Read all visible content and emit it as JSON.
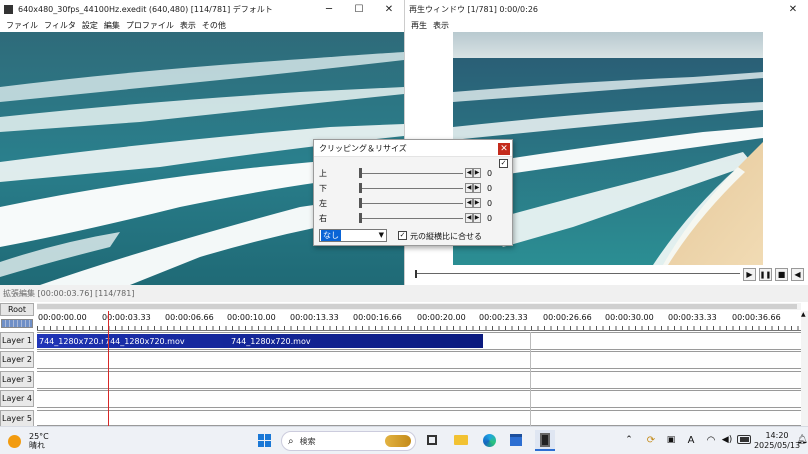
{
  "editor_window": {
    "title": "640x480_30fps_44100Hz.exedit (640,480)  [114/781]  デフォルト",
    "menu": [
      "ファイル",
      "フィルタ",
      "設定",
      "編集",
      "プロファイル",
      "表示",
      "その他"
    ]
  },
  "preview_window": {
    "title": "再生ウィンドウ  [1/781]  0:00/0:26",
    "menu": [
      "再生",
      "表示"
    ]
  },
  "dialog": {
    "title": "クリッピング＆リサイズ",
    "rows": [
      {
        "label": "上",
        "value": "0"
      },
      {
        "label": "下",
        "value": "0"
      },
      {
        "label": "左",
        "value": "0"
      },
      {
        "label": "右",
        "value": "0"
      }
    ],
    "select_value": "なし",
    "checkbox_label": "元の縦横比に合せる"
  },
  "timeline": {
    "header": "拡張編集 [00:00:03.76] [114/781]",
    "root_label": "Root",
    "ticks": [
      "00:00:00.00",
      "00:00:03.33",
      "00:00:06.66",
      "00:00:10.00",
      "00:00:13.33",
      "00:00:16.66",
      "00:00:20.00",
      "00:00:23.33",
      "00:00:26.66",
      "00:00:30.00",
      "00:00:33.33",
      "00:00:36.66"
    ],
    "layers": [
      "Layer 1",
      "Layer 2",
      "Layer 3",
      "Layer 4",
      "Layer 5"
    ],
    "clips": [
      "744_1280x720.mov",
      "744_1280x720.mov",
      "744_1280x720.mov"
    ]
  },
  "taskbar": {
    "weather_temp": "25°C",
    "weather_text": "晴れ",
    "search_placeholder": "検索",
    "time": "14:20",
    "date": "2025/05/13",
    "ime": "A"
  },
  "colors": {
    "clip_start": "#1a2fb8",
    "clip_end": "#0b1a7e",
    "cursor": "#d62828",
    "close_red": "#c42b1c"
  }
}
